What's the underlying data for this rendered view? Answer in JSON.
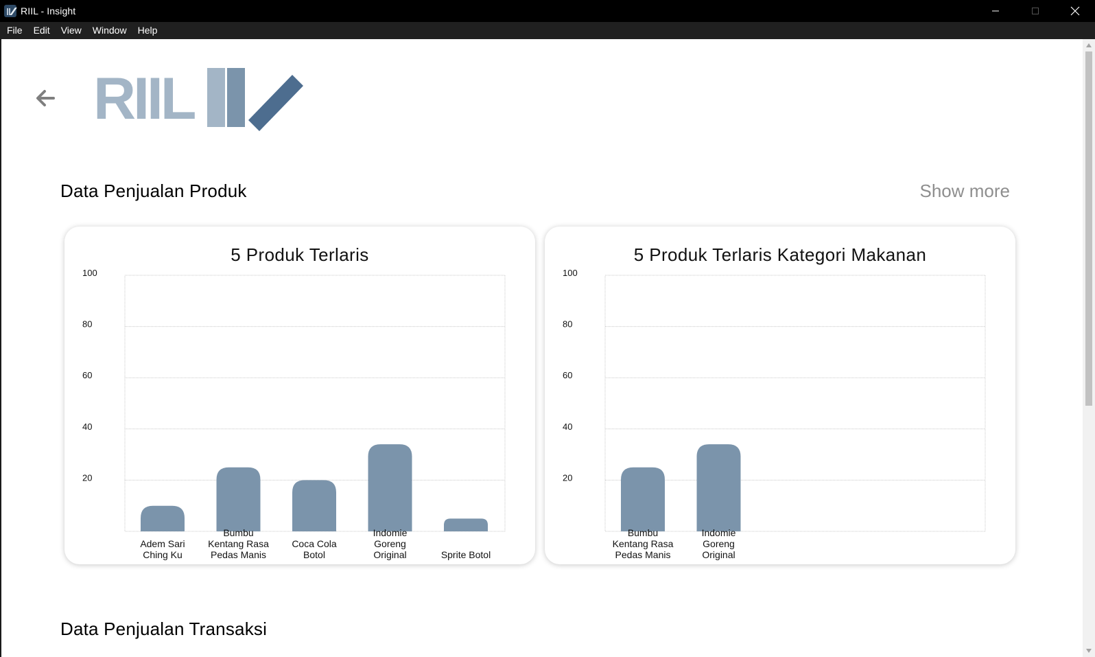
{
  "window": {
    "title": "RIIL - Insight",
    "controls": [
      "minimize-icon",
      "maximize-icon",
      "close-icon"
    ]
  },
  "menu": [
    "File",
    "Edit",
    "View",
    "Window",
    "Help"
  ],
  "header": {
    "back_icon": "arrow-left-icon",
    "logo_text": "RIIL",
    "logo_colors": [
      "#a3b5c6",
      "#7b94ab",
      "#4d6d8f"
    ]
  },
  "sections": {
    "produk": {
      "title": "Data Penjualan Produk",
      "show_more": "Show more"
    },
    "transaksi": {
      "title": "Data Penjualan Transaksi"
    }
  },
  "colors": {
    "bar": "#7b94ab",
    "grid": "#c8c8c8",
    "show_more": "#8e8e8e"
  },
  "chart_data": [
    {
      "type": "bar",
      "title": "5 Produk Terlaris",
      "categories": [
        "Adem Sari Ching Ku",
        "Bumbu Kentang Rasa Pedas Manis",
        "Coca Cola Botol",
        "Indomie Goreng Original",
        "Sprite Botol"
      ],
      "category_lines": [
        [
          "Adem Sari",
          "Ching Ku"
        ],
        [
          "Bumbu",
          "Kentang Rasa",
          "Pedas Manis"
        ],
        [
          "Coca Cola",
          "Botol"
        ],
        [
          "Indomie",
          "Goreng",
          "Original"
        ],
        [
          "Sprite Botol"
        ]
      ],
      "values": [
        10,
        25,
        20,
        34,
        5
      ],
      "yticks": [
        20,
        40,
        60,
        80,
        100
      ],
      "ylim": [
        0,
        100
      ],
      "grid": true
    },
    {
      "type": "bar",
      "title": "5 Produk Terlaris Kategori Makanan",
      "categories": [
        "Bumbu Kentang Rasa Pedas Manis",
        "Indomie Goreng Original"
      ],
      "category_lines": [
        [
          "Bumbu",
          "Kentang Rasa",
          "Pedas Manis"
        ],
        [
          "Indomie",
          "Goreng",
          "Original"
        ]
      ],
      "values": [
        25,
        34
      ],
      "yticks": [
        20,
        40,
        60,
        80,
        100
      ],
      "ylim": [
        0,
        100
      ],
      "grid": true
    }
  ]
}
